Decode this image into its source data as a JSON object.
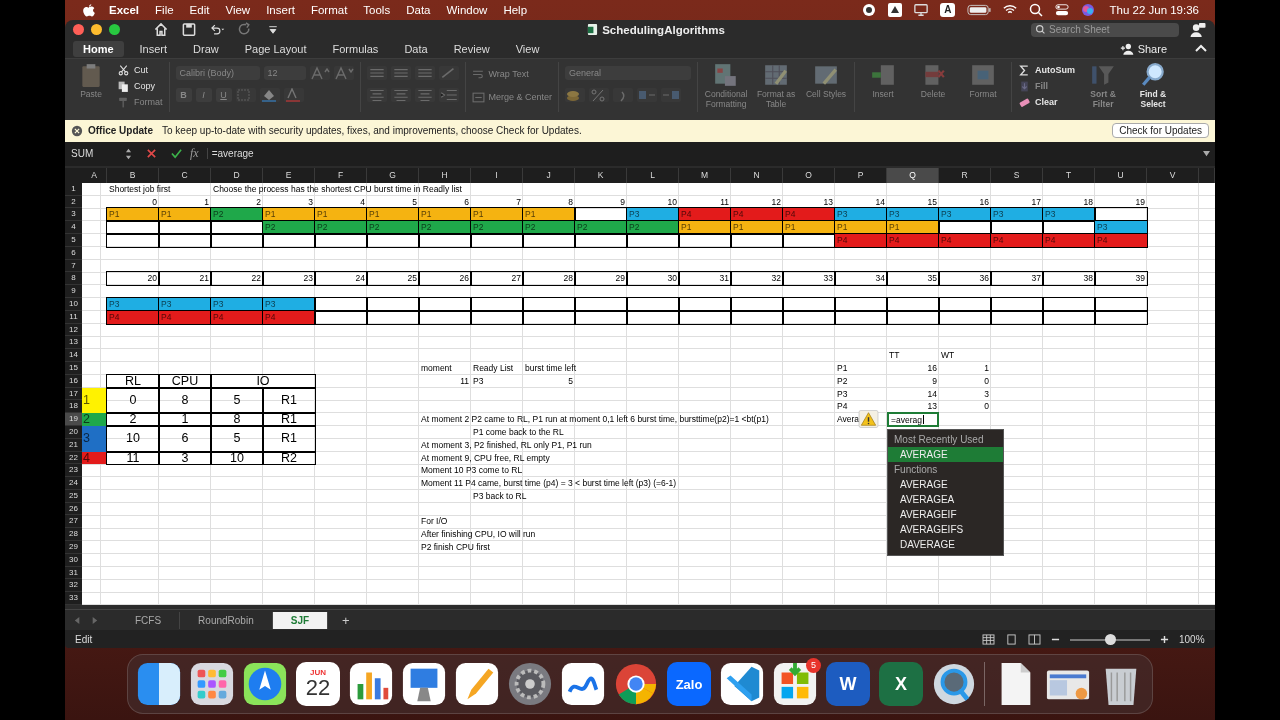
{
  "menu_bar": {
    "app": "Excel",
    "items": [
      "File",
      "Edit",
      "View",
      "Insert",
      "Format",
      "Tools",
      "Data",
      "Window",
      "Help"
    ],
    "input_source": "A",
    "clock": "Thu 22 Jun  19:36"
  },
  "window": {
    "title": "SchedulingAlgorithms",
    "search": {
      "placeholder": "Search Sheet"
    },
    "share": "Share"
  },
  "ribbon_tabs": [
    {
      "label": "Home",
      "selected": true
    },
    {
      "label": "Insert",
      "selected": false
    },
    {
      "label": "Draw",
      "selected": false
    },
    {
      "label": "Page Layout",
      "selected": false
    },
    {
      "label": "Formulas",
      "selected": false
    },
    {
      "label": "Data",
      "selected": false
    },
    {
      "label": "Review",
      "selected": false
    },
    {
      "label": "View",
      "selected": false
    }
  ],
  "ribbon": {
    "paste": {
      "label": "Paste",
      "disabled": true
    },
    "clipboard": [
      {
        "kind": "cut",
        "label": "Cut",
        "disabled": false
      },
      {
        "kind": "copy",
        "label": "Copy",
        "disabled": false
      },
      {
        "kind": "format_painter",
        "label": "Format",
        "disabled": true
      }
    ],
    "font": {
      "family": "Calibri (Body)",
      "size": "12",
      "buttons": [
        "B",
        "I",
        "U"
      ],
      "disabled": true
    },
    "text_controls": [
      {
        "kind": "wrap",
        "label": "Wrap Text",
        "disabled": true
      },
      {
        "kind": "merge",
        "label": "Merge & Center",
        "disabled": true
      }
    ],
    "number_format": {
      "value": "General",
      "disabled": true
    },
    "styles": [
      {
        "kind": "conditional",
        "label": "Conditional Formatting",
        "disabled": true
      },
      {
        "kind": "table",
        "label": "Format as Table",
        "disabled": true
      },
      {
        "kind": "styles",
        "label": "Cell Styles",
        "disabled": true
      }
    ],
    "cells": [
      {
        "kind": "insert",
        "label": "Insert",
        "disabled": true
      },
      {
        "kind": "delete",
        "label": "Delete",
        "disabled": true
      },
      {
        "kind": "format",
        "label": "Format",
        "disabled": true
      }
    ],
    "editing": [
      {
        "kind": "autosum",
        "label": "AutoSum",
        "disabled": false
      },
      {
        "kind": "fill",
        "label": "Fill",
        "disabled": true
      },
      {
        "kind": "clear",
        "label": "Clear",
        "disabled": false
      }
    ],
    "tools": [
      {
        "kind": "sort",
        "label": "Sort & Filter",
        "disabled": true
      },
      {
        "kind": "find",
        "label": "Find & Select",
        "disabled": false
      }
    ]
  },
  "notice": {
    "title": "Office Update",
    "message": "To keep up-to-date with security updates, fixes, and improvements, choose Check for Updates.",
    "button": "Check for Updates"
  },
  "formula_bar": {
    "name_box": "SUM",
    "function_label": "fx",
    "formula": "=average"
  },
  "sheet": {
    "columns": [
      {
        "label": "A",
        "selected": false
      },
      {
        "label": "B",
        "selected": false
      },
      {
        "label": "C",
        "selected": false
      },
      {
        "label": "D",
        "selected": false
      },
      {
        "label": "E",
        "selected": false
      },
      {
        "label": "F",
        "selected": false
      },
      {
        "label": "G",
        "selected": false
      },
      {
        "label": "H",
        "selected": false
      },
      {
        "label": "I",
        "selected": false
      },
      {
        "label": "J",
        "selected": false
      },
      {
        "label": "K",
        "selected": false
      },
      {
        "label": "L",
        "selected": false
      },
      {
        "label": "M",
        "selected": false
      },
      {
        "label": "N",
        "selected": false
      },
      {
        "label": "O",
        "selected": false
      },
      {
        "label": "P",
        "selected": false
      },
      {
        "label": "Q",
        "selected": true
      },
      {
        "label": "R",
        "selected": false
      },
      {
        "label": "S",
        "selected": false
      },
      {
        "label": "T",
        "selected": false
      },
      {
        "label": "U",
        "selected": false
      },
      {
        "label": "V",
        "selected": false
      }
    ],
    "rows": [
      {
        "label": "1",
        "selected": false,
        "cells": [
          {},
          {
            "kind": "text",
            "text": "Shortest job first"
          },
          {},
          {
            "kind": "text",
            "text": "Choose the process has the shortest CPU burst time in Readly list"
          }
        ]
      },
      {
        "label": "2",
        "selected": false,
        "cells": [
          {},
          {
            "kind": "number",
            "text": "0"
          },
          {
            "kind": "number",
            "text": "1"
          },
          {
            "kind": "number",
            "text": "2"
          },
          {
            "kind": "number",
            "text": "3"
          },
          {
            "kind": "number",
            "text": "4"
          },
          {
            "kind": "number",
            "text": "5"
          },
          {
            "kind": "number",
            "text": "6"
          },
          {
            "kind": "number",
            "text": "7"
          },
          {
            "kind": "number",
            "text": "8"
          },
          {
            "kind": "number",
            "text": "9"
          },
          {
            "kind": "number",
            "text": "10"
          },
          {
            "kind": "number",
            "text": "11"
          },
          {
            "kind": "number",
            "text": "12"
          },
          {
            "kind": "number",
            "text": "13"
          },
          {
            "kind": "number",
            "text": "14"
          },
          {
            "kind": "number",
            "text": "15"
          },
          {
            "kind": "number",
            "text": "16"
          },
          {
            "kind": "number",
            "text": "17"
          },
          {
            "kind": "number",
            "text": "18"
          },
          {
            "kind": "number",
            "text": "19"
          }
        ]
      },
      {
        "label": "3",
        "selected": false,
        "cells": [
          {},
          {
            "kind": "block",
            "text": "P1",
            "color": "#f5b311",
            "boxed": true
          },
          {
            "kind": "block",
            "text": "P1",
            "color": "#f5b311",
            "boxed": true
          },
          {
            "kind": "block",
            "text": "P2",
            "color": "#1fa84a",
            "boxed": true
          },
          {
            "kind": "block",
            "text": "P1",
            "color": "#f5b311",
            "boxed": true
          },
          {
            "kind": "block",
            "text": "P1",
            "color": "#f5b311",
            "boxed": true
          },
          {
            "kind": "block",
            "text": "P1",
            "color": "#f5b311",
            "boxed": true
          },
          {
            "kind": "block",
            "text": "P1",
            "color": "#f5b311",
            "boxed": true
          },
          {
            "kind": "block",
            "text": "P1",
            "color": "#f5b311",
            "boxed": true
          },
          {
            "kind": "block",
            "text": "P1",
            "color": "#f5b311",
            "boxed": true
          },
          {
            "boxed": true
          },
          {
            "kind": "block",
            "text": "P3",
            "color": "#1faee3",
            "boxed": true
          },
          {
            "kind": "block",
            "text": "P4",
            "color": "#e31b1b",
            "boxed": true
          },
          {
            "kind": "block",
            "text": "P4",
            "color": "#e31b1b",
            "boxed": true
          },
          {
            "kind": "block",
            "text": "P4",
            "color": "#e31b1b",
            "boxed": true
          },
          {
            "kind": "block",
            "text": "P3",
            "color": "#1faee3",
            "boxed": true
          },
          {
            "kind": "block",
            "text": "P3",
            "color": "#1faee3",
            "boxed": true
          },
          {
            "kind": "block",
            "text": "P3",
            "color": "#1faee3",
            "boxed": true
          },
          {
            "kind": "block",
            "text": "P3",
            "color": "#1faee3",
            "boxed": true
          },
          {
            "kind": "block",
            "text": "P3",
            "color": "#1faee3",
            "boxed": true
          },
          {
            "boxed": true
          }
        ]
      },
      {
        "label": "4",
        "selected": false,
        "cells": [
          {},
          {
            "boxed": true
          },
          {
            "boxed": true
          },
          {
            "boxed": true
          },
          {
            "kind": "block",
            "text": "P2",
            "color": "#1fa84a",
            "boxed": true
          },
          {
            "kind": "block",
            "text": "P2",
            "color": "#1fa84a",
            "boxed": true
          },
          {
            "kind": "block",
            "text": "P2",
            "color": "#1fa84a",
            "boxed": true
          },
          {
            "kind": "block",
            "text": "P2",
            "color": "#1fa84a",
            "boxed": true
          },
          {
            "kind": "block",
            "text": "P2",
            "color": "#1fa84a",
            "boxed": true
          },
          {
            "kind": "block",
            "text": "P2",
            "color": "#1fa84a",
            "boxed": true
          },
          {
            "kind": "block",
            "text": "P2",
            "color": "#1fa84a",
            "boxed": true
          },
          {
            "kind": "block",
            "text": "P2",
            "color": "#1fa84a",
            "boxed": true
          },
          {
            "kind": "block",
            "text": "P1",
            "color": "#f5b311",
            "boxed": true
          },
          {
            "kind": "block",
            "text": "P1",
            "color": "#f5b311",
            "boxed": true
          },
          {
            "kind": "block",
            "text": "P1",
            "color": "#f5b311",
            "boxed": true
          },
          {
            "kind": "block",
            "text": "P1",
            "color": "#f5b311",
            "boxed": true
          },
          {
            "kind": "block",
            "text": "P1",
            "color": "#f5b311",
            "boxed": true
          },
          {
            "boxed": true
          },
          {
            "boxed": true
          },
          {
            "boxed": true
          },
          {
            "kind": "block",
            "text": "P3",
            "color": "#1faee3",
            "boxed": true
          }
        ]
      },
      {
        "label": "5",
        "selected": false,
        "cells": [
          {},
          {
            "boxed": true
          },
          {
            "boxed": true
          },
          {
            "boxed": true
          },
          {
            "boxed": true
          },
          {
            "boxed": true
          },
          {
            "boxed": true
          },
          {
            "boxed": true
          },
          {
            "boxed": true
          },
          {
            "boxed": true
          },
          {
            "boxed": true
          },
          {
            "boxed": true
          },
          {
            "boxed": true
          },
          {
            "boxed": true
          },
          {
            "boxed": true
          },
          {
            "kind": "block",
            "text": "P4",
            "color": "#e31b1b",
            "boxed": true
          },
          {
            "kind": "block",
            "text": "P4",
            "color": "#e31b1b",
            "boxed": true
          },
          {
            "kind": "block",
            "text": "P4",
            "color": "#e31b1b",
            "boxed": true
          },
          {
            "kind": "block",
            "text": "P4",
            "color": "#e31b1b",
            "boxed": true
          },
          {
            "kind": "block",
            "text": "P4",
            "color": "#e31b1b",
            "boxed": true
          },
          {
            "kind": "block",
            "text": "P4",
            "color": "#e31b1b",
            "boxed": true
          }
        ]
      },
      {
        "label": "6",
        "selected": false
      },
      {
        "label": "7",
        "selected": false
      },
      {
        "label": "8",
        "selected": false,
        "cells": [
          {},
          {
            "kind": "number",
            "text": "20",
            "boxed": true
          },
          {
            "kind": "number",
            "text": "21",
            "boxed": true
          },
          {
            "kind": "number",
            "text": "22",
            "boxed": true
          },
          {
            "kind": "number",
            "text": "23",
            "boxed": true
          },
          {
            "kind": "number",
            "text": "24",
            "boxed": true
          },
          {
            "kind": "number",
            "text": "25",
            "boxed": true
          },
          {
            "kind": "number",
            "text": "26",
            "boxed": true
          },
          {
            "kind": "number",
            "text": "27",
            "boxed": true
          },
          {
            "kind": "number",
            "text": "28",
            "boxed": true
          },
          {
            "kind": "number",
            "text": "29",
            "boxed": true
          },
          {
            "kind": "number",
            "text": "30",
            "boxed": true
          },
          {
            "kind": "number",
            "text": "31",
            "boxed": true
          },
          {
            "kind": "number",
            "text": "32",
            "boxed": true
          },
          {
            "kind": "number",
            "text": "33",
            "boxed": true
          },
          {
            "kind": "number",
            "text": "34",
            "boxed": true
          },
          {
            "kind": "number",
            "text": "35",
            "boxed": true
          },
          {
            "kind": "number",
            "text": "36",
            "boxed": true
          },
          {
            "kind": "number",
            "text": "37",
            "boxed": true
          },
          {
            "kind": "number",
            "text": "38",
            "boxed": true
          },
          {
            "kind": "number",
            "text": "39",
            "boxed": true
          }
        ]
      },
      {
        "label": "9",
        "selected": false
      },
      {
        "label": "10",
        "selected": false,
        "cells": [
          {},
          {
            "kind": "block",
            "text": "P3",
            "color": "#1faee3",
            "boxed": true
          },
          {
            "kind": "block",
            "text": "P3",
            "color": "#1faee3",
            "boxed": true
          },
          {
            "kind": "block",
            "text": "P3",
            "color": "#1faee3",
            "boxed": true
          },
          {
            "kind": "block",
            "text": "P3",
            "color": "#1faee3",
            "boxed": true
          },
          {
            "boxed": true
          },
          {
            "boxed": true
          },
          {
            "boxed": true
          },
          {
            "boxed": true
          },
          {
            "boxed": true
          },
          {
            "boxed": true
          },
          {
            "boxed": true
          },
          {
            "boxed": true
          },
          {
            "boxed": true
          },
          {
            "boxed": true
          },
          {
            "boxed": true
          },
          {
            "boxed": true
          },
          {
            "boxed": true
          },
          {
            "boxed": true
          },
          {
            "boxed": true
          },
          {
            "boxed": true
          }
        ]
      },
      {
        "label": "11",
        "selected": false,
        "cells": [
          {},
          {
            "kind": "block",
            "text": "P4",
            "color": "#e31b1b",
            "boxed": true
          },
          {
            "kind": "block",
            "text": "P4",
            "color": "#e31b1b",
            "boxed": true
          },
          {
            "kind": "block",
            "text": "P4",
            "color": "#e31b1b",
            "boxed": true
          },
          {
            "kind": "block",
            "text": "P4",
            "color": "#e31b1b",
            "boxed": true
          },
          {
            "boxed": true
          },
          {
            "boxed": true
          },
          {
            "boxed": true
          },
          {
            "boxed": true
          },
          {
            "boxed": true
          },
          {
            "boxed": true
          },
          {
            "boxed": true
          },
          {
            "boxed": true
          },
          {
            "boxed": true
          },
          {
            "boxed": true
          },
          {
            "boxed": true
          },
          {
            "boxed": true
          },
          {
            "boxed": true
          },
          {
            "boxed": true
          },
          {
            "boxed": true
          },
          {
            "boxed": true
          }
        ]
      },
      {
        "label": "12",
        "selected": false
      },
      {
        "label": "13",
        "selected": false
      },
      {
        "label": "14",
        "selected": false,
        "cells": [
          {},
          {},
          {},
          {},
          {},
          {},
          {},
          {},
          {},
          {},
          {},
          {},
          {},
          {},
          {},
          {},
          {
            "kind": "text",
            "text": "TT"
          },
          {
            "kind": "text",
            "text": "WT"
          }
        ]
      },
      {
        "label": "15",
        "selected": false,
        "cells": [
          {},
          {},
          {},
          {},
          {},
          {},
          {},
          {
            "kind": "text",
            "text": "moment"
          },
          {
            "kind": "text",
            "text": "Ready List"
          },
          {
            "kind": "text",
            "text": "burst time left"
          },
          {},
          {},
          {},
          {},
          {},
          {
            "kind": "text",
            "text": "P1"
          },
          {
            "kind": "number",
            "text": "16"
          },
          {
            "kind": "number",
            "text": "1"
          }
        ]
      },
      {
        "label": "16",
        "selected": false,
        "cells": [
          {},
          {
            "kind": "table",
            "text": "RL",
            "boxed": true
          },
          {
            "kind": "table",
            "text": "CPU",
            "boxed": true
          },
          {
            "kind": "table",
            "text": "IO",
            "boxed": true,
            "merged_right": true
          },
          {},
          {},
          {
            "kind": "number",
            "text": "11"
          },
          {
            "kind": "text",
            "text": "P3"
          },
          {
            "kind": "number",
            "text": "5"
          },
          {},
          {},
          {},
          {},
          {},
          {
            "kind": "text",
            "text": "P2"
          },
          {
            "kind": "number",
            "text": "9"
          },
          {
            "kind": "number",
            "text": "0"
          }
        ]
      },
      {
        "label": "17",
        "selected": false,
        "cells": [
          {
            "kind": "table_label",
            "text": "1",
            "color": "#fff200",
            "merged_down": true
          },
          {
            "kind": "table",
            "text": "0",
            "boxed": true,
            "merged_down": true
          },
          {
            "kind": "table",
            "text": "8",
            "boxed": true,
            "merged_down": true
          },
          {
            "kind": "table",
            "text": "5",
            "boxed": true,
            "merged_down": true
          },
          {
            "kind": "table",
            "text": "R1",
            "boxed": true,
            "merged_down": true
          },
          {},
          {},
          {},
          {},
          {},
          {},
          {},
          {},
          {},
          {},
          {
            "kind": "text",
            "text": "P3"
          },
          {
            "kind": "number",
            "text": "14"
          },
          {
            "kind": "number",
            "text": "3"
          }
        ]
      },
      {
        "label": "18",
        "selected": false,
        "cells": [
          {},
          {},
          {},
          {},
          {},
          {},
          {},
          {},
          {},
          {},
          {
            "kind": "text",
            "text": "P4"
          },
          {
            "kind": "number",
            "text": "13"
          },
          {
            "kind": "number",
            "text": "0"
          }
        ]
      },
      {
        "label": "19",
        "selected": true,
        "cells": [
          {
            "kind": "table_label",
            "text": "2",
            "color": "#1fa84a"
          },
          {
            "kind": "table",
            "text": "2",
            "boxed": true
          },
          {
            "kind": "table",
            "text": "1",
            "boxed": true
          },
          {
            "kind": "table",
            "text": "8",
            "boxed": true
          },
          {
            "kind": "table",
            "text": "R1",
            "boxed": true
          },
          {},
          {},
          {
            "kind": "text",
            "text": "At moment 2 P2 came to RL, P1 run at moment 0,1 left 6 burst time, bursttime(p2)=1 <bt(p1)"
          },
          {},
          {},
          {},
          {},
          {},
          {},
          {},
          {
            "kind": "text",
            "text": "Avera",
            "warning": true
          },
          {
            "kind": "editor",
            "text": "=averag",
            "autocomplete": {
              "sections": [
                {
                  "title": "Most Recently Used",
                  "items": [
                    {
                      "label": "AVERAGE",
                      "selected": true
                    }
                  ]
                },
                {
                  "title": "Functions",
                  "items": [
                    {
                      "label": "AVERAGE",
                      "selected": false
                    },
                    {
                      "label": "AVERAGEA",
                      "selected": false
                    },
                    {
                      "label": "AVERAGEIF",
                      "selected": false
                    },
                    {
                      "label": "AVERAGEIFS",
                      "selected": false
                    },
                    {
                      "label": "DAVERAGE",
                      "selected": false
                    }
                  ]
                }
              ]
            }
          }
        ]
      },
      {
        "label": "20",
        "selected": false,
        "cells": [
          {
            "kind": "table_label",
            "text": "3",
            "color": "#1f6fc5",
            "merged_down": true
          },
          {
            "kind": "table",
            "text": "10",
            "boxed": true,
            "merged_down": true
          },
          {
            "kind": "table",
            "text": "6",
            "boxed": true,
            "merged_down": true
          },
          {
            "kind": "table",
            "text": "5",
            "boxed": true,
            "merged_down": true
          },
          {
            "kind": "table",
            "text": "R1",
            "boxed": true,
            "merged_down": true
          },
          {},
          {},
          {},
          {
            "kind": "text",
            "text": "P1 come back to the RL"
          }
        ]
      },
      {
        "label": "21",
        "selected": false,
        "cells": [
          {},
          {},
          {
            "kind": "text",
            "text": "At moment 3, P2 finished, RL only P1, P1 run"
          }
        ]
      },
      {
        "label": "22",
        "selected": false,
        "cells": [
          {
            "kind": "table_label",
            "text": "4",
            "color": "#e31b1b"
          },
          {
            "kind": "table",
            "text": "11",
            "boxed": true
          },
          {
            "kind": "table",
            "text": "3",
            "boxed": true
          },
          {
            "kind": "table",
            "text": "10",
            "boxed": true
          },
          {
            "kind": "table",
            "text": "R2",
            "boxed": true
          },
          {},
          {},
          {
            "kind": "text",
            "text": "At moment 9, CPU free, RL empty"
          }
        ]
      },
      {
        "label": "23",
        "selected": false,
        "cells": [
          {},
          {},
          {},
          {},
          {},
          {},
          {},
          {
            "kind": "text",
            "text": "Moment 10 P3 come to RL"
          }
        ]
      },
      {
        "label": "24",
        "selected": false,
        "cells": [
          {},
          {},
          {},
          {},
          {},
          {},
          {},
          {
            "kind": "text",
            "text": "Moment 11 P4 came, burst time (p4) = 3 < burst time left (p3) (=6-1)"
          }
        ]
      },
      {
        "label": "25",
        "selected": false,
        "cells": [
          {},
          {},
          {},
          {},
          {},
          {},
          {},
          {},
          {
            "kind": "text",
            "text": "P3 back to RL"
          }
        ]
      },
      {
        "label": "26",
        "selected": false
      },
      {
        "label": "27",
        "selected": false,
        "cells": [
          {},
          {},
          {},
          {},
          {},
          {},
          {},
          {
            "kind": "text",
            "text": "For I/O"
          }
        ]
      },
      {
        "label": "28",
        "selected": false,
        "cells": [
          {},
          {},
          {},
          {},
          {},
          {},
          {},
          {
            "kind": "text",
            "text": "After finishing CPU, IO will run"
          }
        ]
      },
      {
        "label": "29",
        "selected": false,
        "cells": [
          {},
          {},
          {},
          {},
          {},
          {},
          {},
          {
            "kind": "text",
            "text": "P2 finish CPU first"
          }
        ]
      },
      {
        "label": "30",
        "selected": false
      },
      {
        "label": "31",
        "selected": false
      },
      {
        "label": "32",
        "selected": false
      },
      {
        "label": "33",
        "selected": false
      }
    ]
  },
  "sheet_tabs": [
    {
      "label": "FCFS",
      "selected": false
    },
    {
      "label": "RoundRobin",
      "selected": false
    },
    {
      "label": "SJF",
      "selected": true
    }
  ],
  "add_sheet": "+",
  "status_bar": {
    "mode": "Edit",
    "zoom": "100%",
    "level": 0.5
  },
  "dock": [
    {
      "kind": "finder"
    },
    {
      "kind": "launchpad"
    },
    {
      "kind": "compass"
    },
    {
      "kind": "calendar",
      "month": "JUN",
      "day": "22"
    },
    {
      "kind": "numbers"
    },
    {
      "kind": "keynote"
    },
    {
      "kind": "pages"
    },
    {
      "kind": "settings"
    },
    {
      "kind": "freeform"
    },
    {
      "kind": "chrome"
    },
    {
      "kind": "zalo",
      "label": "Zalo"
    },
    {
      "kind": "vscode"
    },
    {
      "kind": "store",
      "badge": "5"
    },
    {
      "kind": "word",
      "label": "W"
    },
    {
      "kind": "excel",
      "label": "X"
    },
    {
      "kind": "quicktime"
    },
    {
      "kind": "divider"
    },
    {
      "kind": "document"
    },
    {
      "kind": "screenshot"
    },
    {
      "kind": "trash"
    }
  ]
}
